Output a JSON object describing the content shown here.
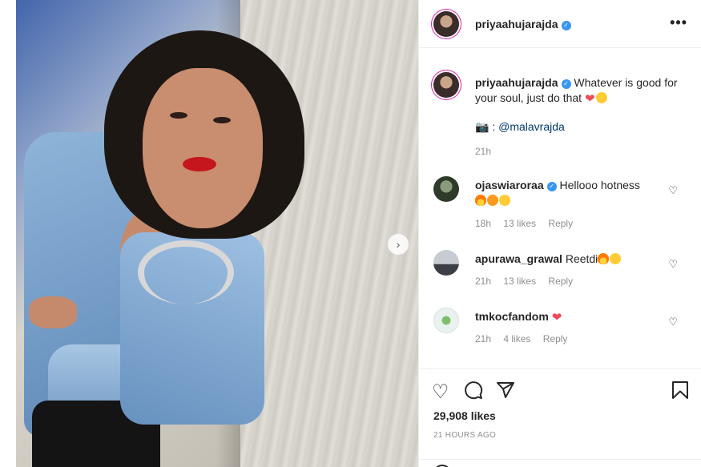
{
  "post": {
    "author": "priyaahujarajda",
    "more_label": "•••",
    "next_label": "›"
  },
  "caption": {
    "author": "priyaahujarajda",
    "text": "Whatever is good for your soul, just do that",
    "credit_prefix": "📷 :",
    "credit_link": "@malavrajda",
    "time": "21h"
  },
  "comments": [
    {
      "author": "ojaswiaroraa",
      "text": "Hellooo hotness",
      "time": "18h",
      "likes": "13 likes",
      "reply": "Reply"
    },
    {
      "author": "apurawa_grawal",
      "text": "Reetdi",
      "time": "21h",
      "likes": "13 likes",
      "reply": "Reply"
    },
    {
      "author": "tmkocfandom",
      "text": "",
      "time": "21h",
      "likes": "4 likes",
      "reply": "Reply"
    }
  ],
  "actions": {
    "likes": "29,908 likes",
    "posted": "21 HOURS AGO"
  },
  "icons": {
    "like": "heart-outline-icon",
    "comment": "comment-icon",
    "share": "paper-plane-icon",
    "save": "bookmark-icon"
  },
  "colors": {
    "verified": "#3897f0",
    "link": "#00376b",
    "muted": "#8e8e8e",
    "heart": "#ed4956"
  }
}
